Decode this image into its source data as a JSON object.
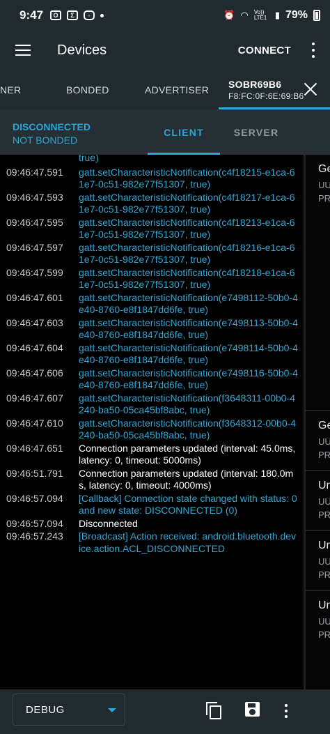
{
  "statusbar": {
    "time": "9:47",
    "icons": [
      "outlook-icon",
      "sigma-icon",
      "instagram-icon"
    ],
    "right_icons": [
      "alarm-icon",
      "wifi-icon",
      "volte-icon",
      "signal-icon"
    ],
    "volte": "Vo)) LTE1",
    "battery": "79%"
  },
  "appbar": {
    "title": "Devices",
    "connect_label": "CONNECT"
  },
  "device_tabs": {
    "tab1": "NER",
    "tab2": "BONDED",
    "tab3": "ADVERTISER",
    "selected_name": "SOBR69B6",
    "selected_mac": "F8:FC:0F:6E:69:B6"
  },
  "connection": {
    "state": "DISCONNECTED",
    "bond": "NOT BONDED",
    "client_tab": "CLIENT",
    "server_tab": "SERVER"
  },
  "log": {
    "top_cont": "true)",
    "rows": [
      {
        "ts": "09:46:47.591",
        "msg": "gatt.setCharacteristicNotification(c4f18215-e1ca-61e7-0c51-982e77f51307, true)",
        "color": "blue"
      },
      {
        "ts": "09:46:47.593",
        "msg": "gatt.setCharacteristicNotification(c4f18217-e1ca-61e7-0c51-982e77f51307, true)",
        "color": "blue"
      },
      {
        "ts": "09:46:47.595",
        "msg": "gatt.setCharacteristicNotification(c4f18213-e1ca-61e7-0c51-982e77f51307, true)",
        "color": "blue"
      },
      {
        "ts": "09:46:47.597",
        "msg": "gatt.setCharacteristicNotification(c4f18216-e1ca-61e7-0c51-982e77f51307, true)",
        "color": "blue"
      },
      {
        "ts": "09:46:47.599",
        "msg": "gatt.setCharacteristicNotification(c4f18218-e1ca-61e7-0c51-982e77f51307, true)",
        "color": "blue"
      },
      {
        "ts": "09:46:47.601",
        "msg": "gatt.setCharacteristicNotification(e7498112-50b0-4e40-8760-e8f1847dd6fe, true)",
        "color": "blue"
      },
      {
        "ts": "09:46:47.603",
        "msg": "gatt.setCharacteristicNotification(e7498113-50b0-4e40-8760-e8f1847dd6fe, true)",
        "color": "blue"
      },
      {
        "ts": "09:46:47.604",
        "msg": "gatt.setCharacteristicNotification(e7498114-50b0-4e40-8760-e8f1847dd6fe, true)",
        "color": "blue"
      },
      {
        "ts": "09:46:47.606",
        "msg": "gatt.setCharacteristicNotification(e7498116-50b0-4e40-8760-e8f1847dd6fe, true)",
        "color": "blue"
      },
      {
        "ts": "09:46:47.607",
        "msg": "gatt.setCharacteristicNotification(f3648311-00b0-4240-ba50-05ca45bf8abc, true)",
        "color": "blue"
      },
      {
        "ts": "09:46:47.610",
        "msg": "gatt.setCharacteristicNotification(f3648312-00b0-4240-ba50-05ca45bf8abc, true)",
        "color": "blue"
      },
      {
        "ts": "09:46:47.651",
        "msg": "Connection parameters updated (interval: 45.0ms, latency: 0, timeout: 5000ms)",
        "color": "white"
      },
      {
        "ts": "09:46:51.791",
        "msg": "Connection parameters updated (interval: 180.0ms, latency: 0, timeout: 4000ms)",
        "color": "white"
      },
      {
        "ts": "09:46:57.094",
        "msg": "[Callback] Connection state changed with status: 0 and new state: DISCONNECTED (0)",
        "color": "blue"
      },
      {
        "ts": "09:46:57.094",
        "msg": "Disconnected",
        "color": "white"
      },
      {
        "ts": "09:46:57.243",
        "msg": "[Broadcast] Action received: android.bluetooth.device.action.ACL_DISCONNECTED",
        "color": "blue"
      }
    ]
  },
  "services": [
    {
      "name": "Ge",
      "l2": "UU",
      "l3": "PR"
    },
    {
      "name": "Ge",
      "l2": "UU",
      "l3": "PR"
    },
    {
      "name": "Ur",
      "l2": "UU",
      "l3": "PR"
    },
    {
      "name": "Ur",
      "l2": "UU",
      "l3": "PR"
    },
    {
      "name": "Ur",
      "l2": "UU",
      "l3": "PR"
    }
  ],
  "bottombar": {
    "log_level": "DEBUG"
  },
  "colors": {
    "accent": "#27a8d8",
    "bar_bg": "#202a2f",
    "log_bg": "#000000"
  }
}
